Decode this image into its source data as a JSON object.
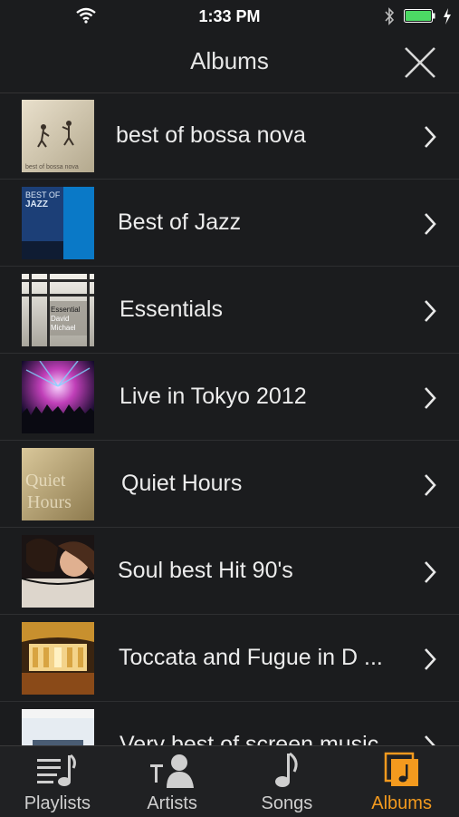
{
  "status_bar": {
    "time": "1:33 PM"
  },
  "header": {
    "title": "Albums"
  },
  "albums": [
    {
      "title": "best of bossa nova",
      "art_text": "best of bossa nova"
    },
    {
      "title": "Best of Jazz",
      "art_text": "BEST OF JAZZ"
    },
    {
      "title": "Essentials",
      "art_text_1": "Essential",
      "art_text_2": "David Michael"
    },
    {
      "title": "Live in Tokyo 2012"
    },
    {
      "title": "Quiet Hours",
      "art_text": "Quiet Hours"
    },
    {
      "title": "Soul best Hit 90's"
    },
    {
      "title": "Toccata and Fugue in D ..."
    },
    {
      "title": "Very best of screen music"
    }
  ],
  "tabs": [
    {
      "label": "Playlists",
      "icon": "playlists-icon"
    },
    {
      "label": "Artists",
      "icon": "artists-icon"
    },
    {
      "label": "Songs",
      "icon": "songs-icon"
    },
    {
      "label": "Albums",
      "icon": "albums-icon"
    }
  ],
  "colors": {
    "accent": "#f39a1e",
    "background": "#1b1c1e",
    "tabbar": "#202123",
    "jazz_blue": "#0a79c7"
  }
}
